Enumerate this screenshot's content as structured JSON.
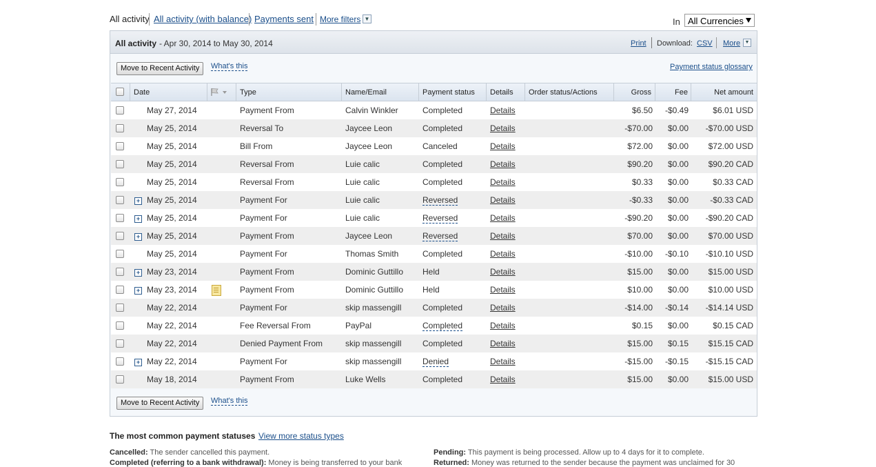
{
  "filters": {
    "tabs": [
      "All activity",
      "All activity (with balance)",
      "Payments sent",
      "More filters"
    ],
    "currency_label": "In",
    "currency_value": "All Currencies"
  },
  "panel": {
    "title": "All activity",
    "date_range": "- Apr 30, 2014 to May 30, 2014",
    "print": "Print",
    "download_label": "Download:",
    "csv": "CSV",
    "more": "More",
    "move_button": "Move to Recent Activity",
    "whats_this": "What's this",
    "glossary": "Payment status glossary"
  },
  "columns": [
    "Date",
    "Type",
    "Name/Email",
    "Payment status",
    "Details",
    "Order status/Actions",
    "Gross",
    "Fee",
    "Net amount"
  ],
  "rows": [
    {
      "date": "May 27, 2014",
      "type": "Payment From",
      "name": "Calvin Winkler",
      "status": "Completed",
      "status_link": false,
      "details": "Details",
      "gross": "$6.50",
      "fee": "-$0.49",
      "net": "$6.01 USD",
      "expand": false,
      "note": false
    },
    {
      "date": "May 25, 2014",
      "type": "Reversal To",
      "name": "Jaycee Leon",
      "status": "Completed",
      "status_link": false,
      "details": "Details",
      "gross": "-$70.00",
      "fee": "$0.00",
      "net": "-$70.00 USD",
      "expand": false,
      "note": false
    },
    {
      "date": "May 25, 2014",
      "type": "Bill From",
      "name": "Jaycee Leon",
      "status": "Canceled",
      "status_link": false,
      "details": "Details",
      "gross": "$72.00",
      "fee": "$0.00",
      "net": "$72.00 USD",
      "expand": false,
      "note": false
    },
    {
      "date": "May 25, 2014",
      "type": "Reversal From",
      "name": "Luie calic",
      "status": "Completed",
      "status_link": false,
      "details": "Details",
      "gross": "$90.20",
      "fee": "$0.00",
      "net": "$90.20 CAD",
      "expand": false,
      "note": false
    },
    {
      "date": "May 25, 2014",
      "type": "Reversal From",
      "name": "Luie calic",
      "status": "Completed",
      "status_link": false,
      "details": "Details",
      "gross": "$0.33",
      "fee": "$0.00",
      "net": "$0.33 CAD",
      "expand": false,
      "note": false
    },
    {
      "date": "May 25, 2014",
      "type": "Payment For",
      "name": "Luie calic",
      "status": "Reversed",
      "status_link": true,
      "details": "Details",
      "gross": "-$0.33",
      "fee": "$0.00",
      "net": "-$0.33 CAD",
      "expand": true,
      "note": false
    },
    {
      "date": "May 25, 2014",
      "type": "Payment For",
      "name": "Luie calic",
      "status": "Reversed",
      "status_link": true,
      "details": "Details",
      "gross": "-$90.20",
      "fee": "$0.00",
      "net": "-$90.20 CAD",
      "expand": true,
      "note": false
    },
    {
      "date": "May 25, 2014",
      "type": "Payment From",
      "name": "Jaycee Leon",
      "status": "Reversed",
      "status_link": true,
      "details": "Details",
      "gross": "$70.00",
      "fee": "$0.00",
      "net": "$70.00 USD",
      "expand": true,
      "note": false
    },
    {
      "date": "May 25, 2014",
      "type": "Payment For",
      "name": "Thomas Smith",
      "status": "Completed",
      "status_link": false,
      "details": "Details",
      "gross": "-$10.00",
      "fee": "-$0.10",
      "net": "-$10.10 USD",
      "expand": false,
      "note": false
    },
    {
      "date": "May 23, 2014",
      "type": "Payment From",
      "name": "Dominic Guttillo",
      "status": "Held",
      "status_link": false,
      "details": "Details",
      "gross": "$15.00",
      "fee": "$0.00",
      "net": "$15.00 USD",
      "expand": true,
      "note": false
    },
    {
      "date": "May 23, 2014",
      "type": "Payment From",
      "name": "Dominic Guttillo",
      "status": "Held",
      "status_link": false,
      "details": "Details",
      "gross": "$10.00",
      "fee": "$0.00",
      "net": "$10.00 USD",
      "expand": true,
      "note": true
    },
    {
      "date": "May 22, 2014",
      "type": "Payment For",
      "name": "skip massengill",
      "status": "Completed",
      "status_link": false,
      "details": "Details",
      "gross": "-$14.00",
      "fee": "-$0.14",
      "net": "-$14.14 USD",
      "expand": false,
      "note": false
    },
    {
      "date": "May 22, 2014",
      "type": "Fee Reversal From",
      "name": "PayPal",
      "status": "Completed",
      "status_link": true,
      "details": "Details",
      "gross": "$0.15",
      "fee": "$0.00",
      "net": "$0.15 CAD",
      "expand": false,
      "note": false
    },
    {
      "date": "May 22, 2014",
      "type": "Denied Payment From",
      "name": "skip massengill",
      "status": "Completed",
      "status_link": false,
      "details": "Details",
      "gross": "$15.00",
      "fee": "$0.15",
      "net": "$15.15 CAD",
      "expand": false,
      "note": false
    },
    {
      "date": "May 22, 2014",
      "type": "Payment For",
      "name": "skip massengill",
      "status": "Denied",
      "status_link": true,
      "details": "Details",
      "gross": "-$15.00",
      "fee": "-$0.15",
      "net": "-$15.15 CAD",
      "expand": true,
      "note": false
    },
    {
      "date": "May 18, 2014",
      "type": "Payment From",
      "name": "Luke Wells",
      "status": "Completed",
      "status_link": false,
      "details": "Details",
      "gross": "$15.00",
      "fee": "$0.00",
      "net": "$15.00 USD",
      "expand": false,
      "note": false
    }
  ],
  "legend": {
    "title": "The most common payment statuses",
    "link": "View more status types",
    "cancelled_term": "Cancelled:",
    "cancelled_text": "The sender cancelled this payment.",
    "completed_term": "Completed (referring to a bank withdrawal):",
    "completed_text": "Money is being transferred to your bank",
    "pending_term": "Pending:",
    "pending_text": "This payment is being processed. Allow up to 4 days for it to complete.",
    "returned_term": "Returned:",
    "returned_text": "Money was returned to the sender because the payment was unclaimed for 30"
  }
}
